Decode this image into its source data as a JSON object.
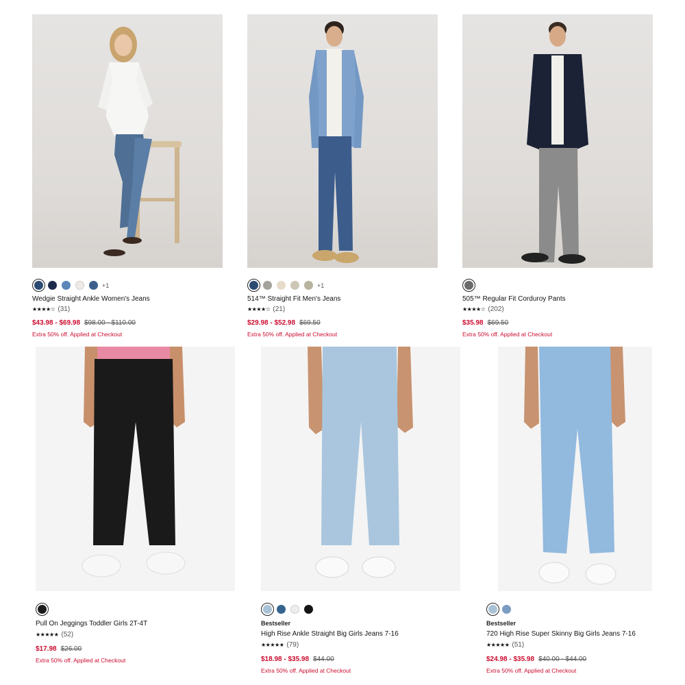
{
  "products": [
    {
      "name": "Wedgie Straight Ankle Women's Jeans",
      "tag": "",
      "rating_count": "(31)",
      "stars": "★★★★☆",
      "sale_price": "$43.98 - $69.98",
      "original_price": "$98.00 - $110.00",
      "promo": "Extra 50% off. Applied at Checkout",
      "more_colors": "+1",
      "swatches": [
        "#2c4a72",
        "#1f2b4a",
        "#5b86b8",
        "#eeebe6",
        "#3d5f8c"
      ]
    },
    {
      "name": "514™ Straight Fit Men's Jeans",
      "tag": "",
      "rating_count": "(21)",
      "stars": "★★★★☆",
      "sale_price": "$29.98 - $52.98",
      "original_price": "$69.50",
      "promo": "Extra 50% off. Applied at Checkout",
      "more_colors": "+1",
      "swatches": [
        "#2c4a72",
        "#a3a29c",
        "#e6dcc9",
        "#cdc6b6",
        "#b7b39f"
      ]
    },
    {
      "name": "505™ Regular Fit Corduroy Pants",
      "tag": "",
      "rating_count": "(202)",
      "stars": "★★★★☆",
      "sale_price": "$35.98",
      "original_price": "$69.50",
      "promo": "Extra 50% off. Applied at Checkout",
      "more_colors": "",
      "swatches": [
        "#6a6a6a"
      ]
    },
    {
      "name": "Pull On Jeggings Toddler Girls 2T-4T",
      "tag": "",
      "rating_count": "(52)",
      "stars": "★★★★★",
      "sale_price": "$17.98",
      "original_price": "$26.00",
      "promo": "Extra 50% off. Applied at Checkout",
      "more_colors": "",
      "swatches": [
        "#1c1c1c"
      ]
    },
    {
      "name": "High Rise Ankle Straight Big Girls Jeans 7-16",
      "tag": "Bestseller",
      "rating_count": "(79)",
      "stars": "★★★★★",
      "sale_price": "$18.98 - $35.98",
      "original_price": "$44.00",
      "promo": "Extra 50% off. Applied at Checkout",
      "more_colors": "",
      "swatches": [
        "#a9c2d6",
        "#36638f",
        "#eeeeee",
        "#151515"
      ]
    },
    {
      "name": "720 High Rise Super Skinny Big Girls Jeans 7-16",
      "tag": "Bestseller",
      "rating_count": "(51)",
      "stars": "★★★★★",
      "sale_price": "$24.98 - $35.98",
      "original_price": "$40.00 - $44.00",
      "promo": "Extra 50% off. Applied at Checkout",
      "more_colors": "",
      "swatches": [
        "#a9c2d6",
        "#7a9cc3"
      ]
    }
  ],
  "colors": {
    "sale": "#cc0c2f",
    "studio_bg": "#e2dfdc",
    "product_bg": "#f4f4f4"
  }
}
